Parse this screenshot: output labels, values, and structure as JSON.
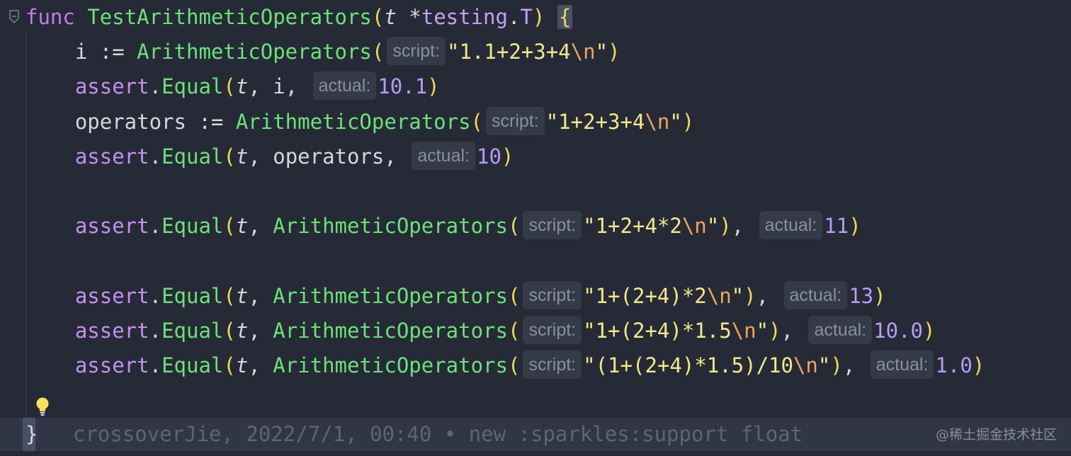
{
  "lines": [
    {
      "tokens": [
        {
          "c": "kw",
          "t": "func"
        },
        {
          "c": "op",
          "t": " "
        },
        {
          "c": "fn",
          "t": "TestArithmeticOperators"
        },
        {
          "c": "par",
          "t": "("
        },
        {
          "c": "id ital",
          "t": "t"
        },
        {
          "c": "op",
          "t": " *"
        },
        {
          "c": "ty",
          "t": "testing"
        },
        {
          "c": "op",
          "t": "."
        },
        {
          "c": "ty",
          "t": "T"
        },
        {
          "c": "par",
          "t": ")"
        },
        {
          "c": "op",
          "t": " "
        },
        {
          "c": "par brace-hl",
          "t": "{"
        }
      ]
    },
    {
      "tokens": [
        {
          "c": "id",
          "t": "    i := "
        },
        {
          "c": "fn",
          "t": "ArithmeticOperators"
        },
        {
          "c": "par",
          "t": "("
        },
        {
          "hint": "script:"
        },
        {
          "c": "str",
          "t": "\"1.1+2+3+4"
        },
        {
          "c": "esc",
          "t": "\\n"
        },
        {
          "c": "str",
          "t": "\""
        },
        {
          "c": "par",
          "t": ")"
        }
      ]
    },
    {
      "tokens": [
        {
          "c": "pkg",
          "t": "    assert"
        },
        {
          "c": "op",
          "t": "."
        },
        {
          "c": "fn",
          "t": "Equal"
        },
        {
          "c": "par",
          "t": "("
        },
        {
          "c": "id ital",
          "t": "t"
        },
        {
          "c": "op",
          "t": ", i, "
        },
        {
          "hint": "actual:"
        },
        {
          "c": "num",
          "t": "10.1"
        },
        {
          "c": "par",
          "t": ")"
        }
      ]
    },
    {
      "tokens": [
        {
          "c": "id",
          "t": "    operators := "
        },
        {
          "c": "fn",
          "t": "ArithmeticOperators"
        },
        {
          "c": "par",
          "t": "("
        },
        {
          "hint": "script:"
        },
        {
          "c": "str",
          "t": "\"1+2+3+4"
        },
        {
          "c": "esc",
          "t": "\\n"
        },
        {
          "c": "str",
          "t": "\""
        },
        {
          "c": "par",
          "t": ")"
        }
      ]
    },
    {
      "tokens": [
        {
          "c": "pkg",
          "t": "    assert"
        },
        {
          "c": "op",
          "t": "."
        },
        {
          "c": "fn",
          "t": "Equal"
        },
        {
          "c": "par",
          "t": "("
        },
        {
          "c": "id ital",
          "t": "t"
        },
        {
          "c": "op",
          "t": ", operators, "
        },
        {
          "hint": "actual:"
        },
        {
          "c": "num",
          "t": "10"
        },
        {
          "c": "par",
          "t": ")"
        }
      ]
    },
    {
      "tokens": []
    },
    {
      "tokens": [
        {
          "c": "pkg",
          "t": "    assert"
        },
        {
          "c": "op",
          "t": "."
        },
        {
          "c": "fn",
          "t": "Equal"
        },
        {
          "c": "par",
          "t": "("
        },
        {
          "c": "id ital",
          "t": "t"
        },
        {
          "c": "op",
          "t": ", "
        },
        {
          "c": "fn",
          "t": "ArithmeticOperators"
        },
        {
          "c": "par",
          "t": "("
        },
        {
          "hint": "script:"
        },
        {
          "c": "str",
          "t": "\"1+2+4*2"
        },
        {
          "c": "esc",
          "t": "\\n"
        },
        {
          "c": "str",
          "t": "\""
        },
        {
          "c": "par",
          "t": ")"
        },
        {
          "c": "op",
          "t": ", "
        },
        {
          "hint": "actual:"
        },
        {
          "c": "num",
          "t": "11"
        },
        {
          "c": "par",
          "t": ")"
        }
      ]
    },
    {
      "tokens": []
    },
    {
      "tokens": [
        {
          "c": "pkg",
          "t": "    assert"
        },
        {
          "c": "op",
          "t": "."
        },
        {
          "c": "fn",
          "t": "Equal"
        },
        {
          "c": "par",
          "t": "("
        },
        {
          "c": "id ital",
          "t": "t"
        },
        {
          "c": "op",
          "t": ", "
        },
        {
          "c": "fn",
          "t": "ArithmeticOperators"
        },
        {
          "c": "par",
          "t": "("
        },
        {
          "hint": "script:"
        },
        {
          "c": "str",
          "t": "\"1+(2+4)*2"
        },
        {
          "c": "esc",
          "t": "\\n"
        },
        {
          "c": "str",
          "t": "\""
        },
        {
          "c": "par",
          "t": ")"
        },
        {
          "c": "op",
          "t": ", "
        },
        {
          "hint": "actual:"
        },
        {
          "c": "num",
          "t": "13"
        },
        {
          "c": "par",
          "t": ")"
        }
      ]
    },
    {
      "tokens": [
        {
          "c": "pkg",
          "t": "    assert"
        },
        {
          "c": "op",
          "t": "."
        },
        {
          "c": "fn",
          "t": "Equal"
        },
        {
          "c": "par",
          "t": "("
        },
        {
          "c": "id ital",
          "t": "t"
        },
        {
          "c": "op",
          "t": ", "
        },
        {
          "c": "fn",
          "t": "ArithmeticOperators"
        },
        {
          "c": "par",
          "t": "("
        },
        {
          "hint": "script:"
        },
        {
          "c": "str",
          "t": "\"1+(2+4)*1.5"
        },
        {
          "c": "esc",
          "t": "\\n"
        },
        {
          "c": "str",
          "t": "\""
        },
        {
          "c": "par",
          "t": ")"
        },
        {
          "c": "op",
          "t": ", "
        },
        {
          "hint": "actual:"
        },
        {
          "c": "num",
          "t": "10.0"
        },
        {
          "c": "par",
          "t": ")"
        }
      ]
    },
    {
      "tokens": [
        {
          "c": "pkg",
          "t": "    assert"
        },
        {
          "c": "op",
          "t": "."
        },
        {
          "c": "fn",
          "t": "Equal"
        },
        {
          "c": "par",
          "t": "("
        },
        {
          "c": "id ital",
          "t": "t"
        },
        {
          "c": "op",
          "t": ", "
        },
        {
          "c": "fn",
          "t": "ArithmeticOperators"
        },
        {
          "c": "par",
          "t": "("
        },
        {
          "hint": "script:"
        },
        {
          "c": "str",
          "t": "\"(1+(2+4)*1.5)/10"
        },
        {
          "c": "esc",
          "t": "\\n"
        },
        {
          "c": "str",
          "t": "\""
        },
        {
          "c": "par",
          "t": ")"
        },
        {
          "c": "op",
          "t": ", "
        },
        {
          "hint": "actual:"
        },
        {
          "c": "num",
          "t": "1.0"
        },
        {
          "c": "par",
          "t": ")"
        }
      ]
    }
  ],
  "closing_brace": "}",
  "blame": "crossoverJie, 2022/7/1, 00:40 • new :sparkles:support float",
  "watermark": "@稀土掘金技术社区",
  "icons": {
    "fold_top": "fold-collapse-icon",
    "fold_bottom": "fold-end-icon",
    "bulb": "lightbulb-icon"
  },
  "colors": {
    "background": "#262a36",
    "keyword": "#c27be6",
    "function": "#6de07a",
    "string": "#f3e88a",
    "escape": "#f0a35a",
    "number": "#b79bf5",
    "paren": "#f0d85a",
    "blame_text": "#5f6474"
  }
}
